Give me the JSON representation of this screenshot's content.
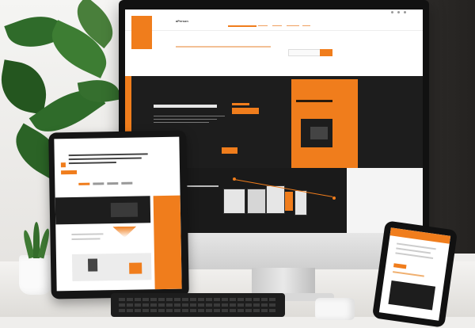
{
  "site": {
    "logo_text": "aPerson",
    "nav_items": [
      "",
      "",
      "",
      "",
      ""
    ],
    "tagline": "",
    "hero_title": "",
    "hero_subtitle": "",
    "big_number_label": "",
    "big_number": "",
    "orange_heading": ""
  },
  "colors": {
    "accent": "#f07d1c",
    "dark": "#1d1d1d",
    "screen_bg": "#ffffff"
  }
}
